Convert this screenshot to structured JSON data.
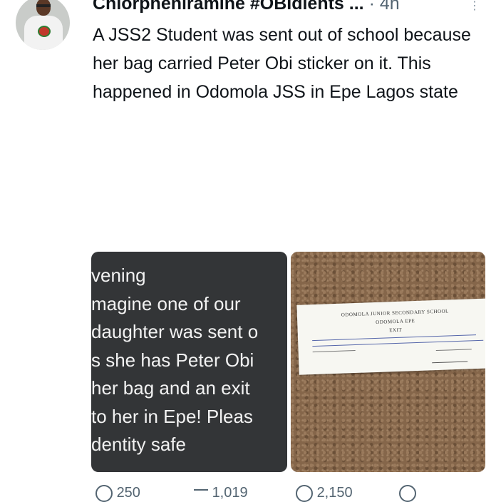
{
  "tweet": {
    "author": "Chlorpheniramine #OBIdients ...",
    "separator": "·",
    "time": "4h",
    "more": "⋮",
    "text": "A JSS2 Student was sent out of school because her bag carried Peter Obi sticker on it. This happened in Odomola JSS in Epe Lagos state"
  },
  "media": {
    "left_lines": [
      "vening",
      "magine one of our",
      "daughter was sent o",
      "s she has Peter Obi",
      " her bag and an exit",
      " to her in Epe! Pleas",
      "dentity safe"
    ],
    "letter": {
      "school": "ODOMOLA JUNIOR SECONDARY SCHOOL",
      "place": "ODOMOLA EPE",
      "title": "EXIT"
    }
  },
  "actions": {
    "reply_count": "250",
    "retweet_count": "1,019",
    "like_count": "2,150"
  }
}
